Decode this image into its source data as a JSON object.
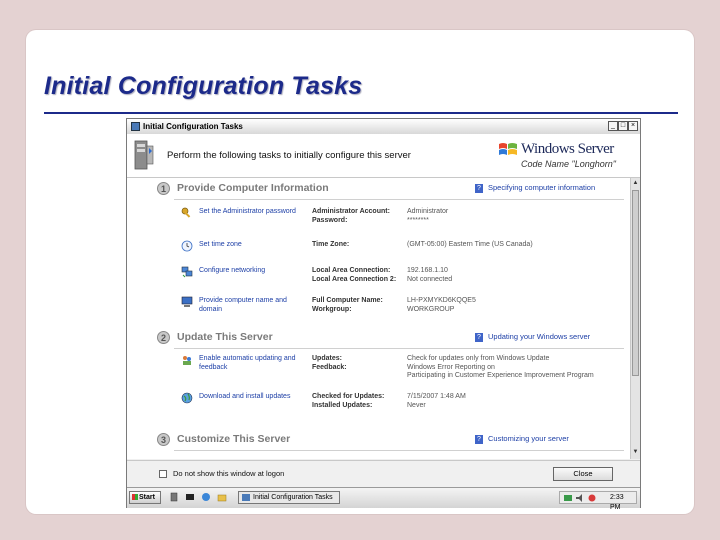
{
  "slide": {
    "title": "Initial Configuration Tasks"
  },
  "window": {
    "title": "Initial Configuration Tasks",
    "controls": {
      "minimize": "_",
      "maximize": "□",
      "close": "×"
    },
    "header_text": "Perform the following tasks to initially configure this server",
    "logo_name": "Windows Server",
    "logo_code": "Code Name \"Longhorn\""
  },
  "sections": [
    {
      "number": "1",
      "title": "Provide Computer Information",
      "help": "Specifying computer information",
      "tasks": [
        {
          "icon": "key-icon",
          "link": "Set the Administrator password",
          "labels": [
            "Administrator Account:",
            "Password:"
          ],
          "values": [
            "Administrator",
            "********"
          ]
        },
        {
          "icon": "clock-icon",
          "link": "Set time zone",
          "labels": [
            "Time Zone:"
          ],
          "values": [
            "(GMT-05:00) Eastern Time (US Canada)"
          ]
        },
        {
          "icon": "network-icon",
          "link": "Configure networking",
          "labels": [
            "Local Area Connection:",
            "Local Area Connection 2:"
          ],
          "values": [
            "192.168.1.10",
            "Not connected"
          ]
        },
        {
          "icon": "computer-icon",
          "link": "Provide computer name and domain",
          "labels": [
            "Full Computer Name:",
            "Workgroup:"
          ],
          "values": [
            "LH-PXMYKD6KQQE5",
            "WORKGROUP"
          ]
        }
      ]
    },
    {
      "number": "2",
      "title": "Update This Server",
      "help": "Updating your Windows server",
      "tasks": [
        {
          "icon": "users-icon",
          "link": "Enable automatic updating and feedback",
          "labels": [
            "Updates:",
            "Feedback:"
          ],
          "values": [
            "Check for updates only from Windows Update",
            "Windows Error Reporting on",
            "Participating in Customer Experience Improvement Program"
          ]
        },
        {
          "icon": "globe-icon",
          "link": "Download and install updates",
          "labels": [
            "Checked for Updates:",
            "Installed Updates:"
          ],
          "values": [
            "7/15/2007 1:48 AM",
            "Never"
          ]
        }
      ]
    },
    {
      "number": "3",
      "title": "Customize This Server",
      "help": "Customizing your server",
      "tasks": []
    }
  ],
  "footer": {
    "checkbox_label": "Do not show this window at logon",
    "checkbox_checked": false,
    "close_label": "Close"
  },
  "taskbar": {
    "start_label": "Start",
    "task_button_label": "Initial Configuration Tasks",
    "clock": "2:33 PM"
  }
}
